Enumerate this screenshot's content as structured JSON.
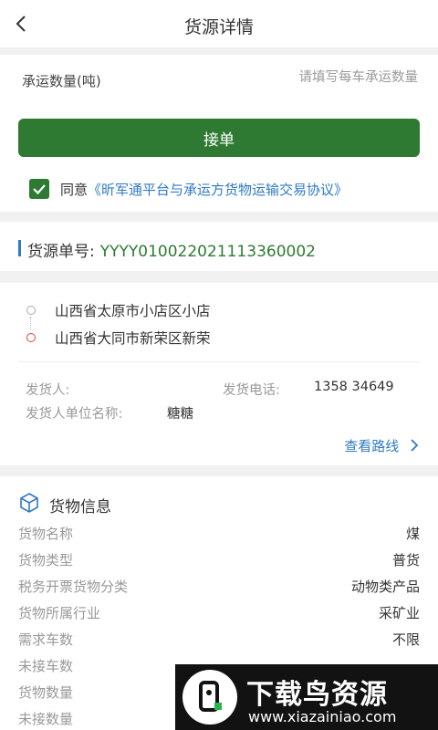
{
  "header": {
    "title": "货源详情"
  },
  "capacity": {
    "label": "承运数量(吨)",
    "placeholder": "请填写每车承运数量"
  },
  "accept_label": "接单",
  "agreement": {
    "prefix": "同意",
    "link": "《昕军通平台与承运方货物运输交易协议》",
    "checked": true
  },
  "order": {
    "label": "货源单号:",
    "number": "YYYY010022021113360002"
  },
  "route": {
    "from": "山西省太原市小店区小店",
    "to": "山西省大同市新荣区新荣",
    "shipper_label": "发货人:",
    "phone_label": "发货电话:",
    "phone_value": "1358  34649",
    "company_label": "发货人单位名称:",
    "company_value": "糖糖",
    "view_route": "查看路线"
  },
  "cargo": {
    "title": "货物信息",
    "items": [
      {
        "label": "货物名称",
        "value": "煤"
      },
      {
        "label": "货物类型",
        "value": "普货"
      },
      {
        "label": "税务开票货物分类",
        "value": "动物类产品"
      },
      {
        "label": "货物所属行业",
        "value": "采矿业"
      },
      {
        "label": "需求车数",
        "value": "不限"
      },
      {
        "label": "未接车数",
        "value": ""
      },
      {
        "label": "货物数量",
        "value": ""
      },
      {
        "label": "未接数量",
        "value": ""
      }
    ]
  },
  "watermark": {
    "title": "下载鸟资源",
    "url": "www.xiazainiao.com"
  }
}
